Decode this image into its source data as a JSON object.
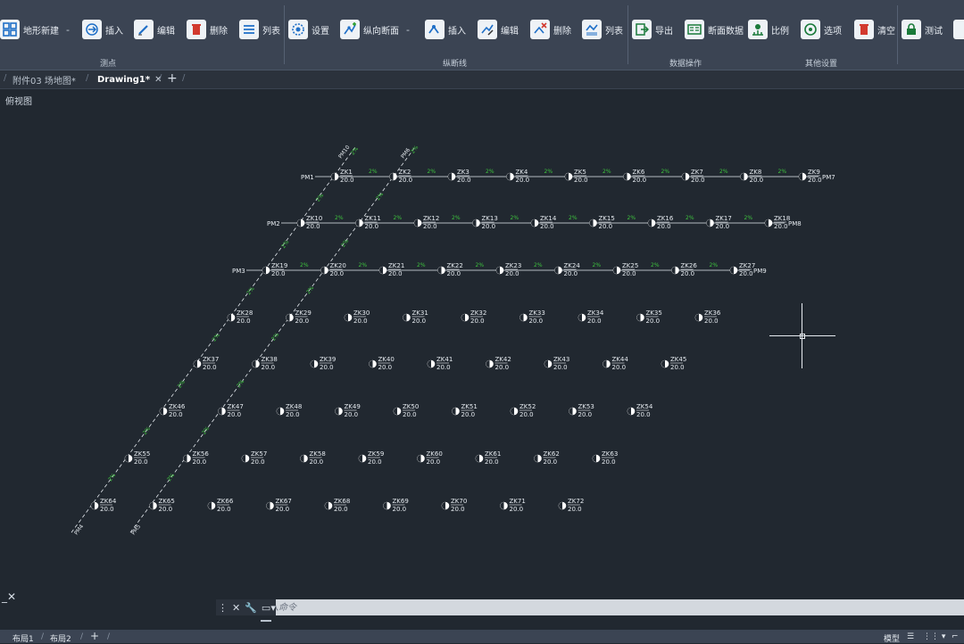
{
  "ribbon": {
    "buttons": [
      {
        "id": "terrain-new",
        "label": "地形新建",
        "icon": "grid-icon",
        "dash": true
      },
      {
        "id": "insert",
        "label": "插入",
        "icon": "insert-arrow-icon"
      },
      {
        "id": "edit",
        "label": "编辑",
        "icon": "edit-pen-icon"
      },
      {
        "id": "delete",
        "label": "删除",
        "icon": "trash-icon"
      },
      {
        "id": "list",
        "label": "列表",
        "icon": "list-icon"
      },
      {
        "id": "settings",
        "label": "设置",
        "icon": "gear-icon"
      },
      {
        "id": "profile-new",
        "label": "纵向断面",
        "icon": "profile-add-icon",
        "dash": true
      },
      {
        "id": "line-insert",
        "label": "插入",
        "icon": "line-insert-icon"
      },
      {
        "id": "line-edit",
        "label": "编辑",
        "icon": "line-edit-icon"
      },
      {
        "id": "line-delete",
        "label": "删除",
        "icon": "line-delete-icon"
      },
      {
        "id": "line-list",
        "label": "列表",
        "icon": "line-list-icon"
      },
      {
        "id": "export",
        "label": "导出",
        "icon": "export-icon"
      },
      {
        "id": "section-data",
        "label": "断面数据",
        "icon": "section-data-icon"
      },
      {
        "id": "scale",
        "label": "比例",
        "icon": "scale-icon"
      },
      {
        "id": "options",
        "label": "选项",
        "icon": "target-icon"
      },
      {
        "id": "clear",
        "label": "清空",
        "icon": "clear-icon"
      },
      {
        "id": "lock",
        "label": "测试",
        "icon": "lock-icon"
      }
    ],
    "groups": [
      "测点",
      "纵断线",
      "数据操作",
      "其他设置"
    ]
  },
  "tabs": [
    {
      "label": "附件03  场地图*",
      "active": false
    },
    {
      "label": "Drawing1*",
      "active": true
    }
  ],
  "view_label": "俯视图",
  "drawing": {
    "rows": [
      {
        "start": "PM1",
        "end": "PM7",
        "dims": [
          "2%",
          "2%",
          "2%",
          "2%",
          "2%",
          "2%",
          "2%",
          "2%"
        ],
        "points": [
          {
            "n": "ZK1",
            "e": "20.0"
          },
          {
            "n": "ZK2",
            "e": "20.0"
          },
          {
            "n": "ZK3",
            "e": "20.0"
          },
          {
            "n": "ZK4",
            "e": "20.0"
          },
          {
            "n": "ZK5",
            "e": "20.0"
          },
          {
            "n": "ZK6",
            "e": "20.0"
          },
          {
            "n": "ZK7",
            "e": "20.0"
          },
          {
            "n": "ZK8",
            "e": "20.0"
          },
          {
            "n": "ZK9",
            "e": "20.0"
          }
        ]
      },
      {
        "start": "PM2",
        "end": "PM8",
        "dims": [
          "2%",
          "2%",
          "2%",
          "2%",
          "2%",
          "2%",
          "2%",
          "2%"
        ],
        "points": [
          {
            "n": "ZK10",
            "e": "20.0"
          },
          {
            "n": "ZK11",
            "e": "20.0"
          },
          {
            "n": "ZK12",
            "e": "20.0"
          },
          {
            "n": "ZK13",
            "e": "20.0"
          },
          {
            "n": "ZK14",
            "e": "20.0"
          },
          {
            "n": "ZK15",
            "e": "20.0"
          },
          {
            "n": "ZK16",
            "e": "20.0"
          },
          {
            "n": "ZK17",
            "e": "20.0"
          },
          {
            "n": "ZK18",
            "e": "20.0"
          }
        ]
      },
      {
        "start": "PM3",
        "end": "PM9",
        "dims": [
          "2%",
          "2%",
          "2%",
          "2%",
          "2%",
          "2%",
          "2%",
          "2%"
        ],
        "points": [
          {
            "n": "ZK19",
            "e": "20.0"
          },
          {
            "n": "ZK20",
            "e": "20.0"
          },
          {
            "n": "ZK21",
            "e": "20.0"
          },
          {
            "n": "ZK22",
            "e": "20.0"
          },
          {
            "n": "ZK23",
            "e": "20.0"
          },
          {
            "n": "ZK24",
            "e": "20.0"
          },
          {
            "n": "ZK25",
            "e": "20.0"
          },
          {
            "n": "ZK26",
            "e": "20.0"
          },
          {
            "n": "ZK27",
            "e": "20.0"
          }
        ]
      },
      {
        "points": [
          {
            "n": "ZK28",
            "e": "20.0"
          },
          {
            "n": "ZK29",
            "e": "20.0"
          },
          {
            "n": "ZK30",
            "e": "20.0"
          },
          {
            "n": "ZK31",
            "e": "20.0"
          },
          {
            "n": "ZK32",
            "e": "20.0"
          },
          {
            "n": "ZK33",
            "e": "20.0"
          },
          {
            "n": "ZK34",
            "e": "20.0"
          },
          {
            "n": "ZK35",
            "e": "20.0"
          },
          {
            "n": "ZK36",
            "e": "20.0"
          }
        ]
      },
      {
        "points": [
          {
            "n": "ZK37",
            "e": "20.0"
          },
          {
            "n": "ZK38",
            "e": "20.0"
          },
          {
            "n": "ZK39",
            "e": "20.0"
          },
          {
            "n": "ZK40",
            "e": "20.0"
          },
          {
            "n": "ZK41",
            "e": "20.0"
          },
          {
            "n": "ZK42",
            "e": "20.0"
          },
          {
            "n": "ZK43",
            "e": "20.0"
          },
          {
            "n": "ZK44",
            "e": "20.0"
          },
          {
            "n": "ZK45",
            "e": "20.0"
          }
        ]
      },
      {
        "points": [
          {
            "n": "ZK46",
            "e": "20.0"
          },
          {
            "n": "ZK47",
            "e": "20.0"
          },
          {
            "n": "ZK48",
            "e": "20.0"
          },
          {
            "n": "ZK49",
            "e": "20.0"
          },
          {
            "n": "ZK50",
            "e": "20.0"
          },
          {
            "n": "ZK51",
            "e": "20.0"
          },
          {
            "n": "ZK52",
            "e": "20.0"
          },
          {
            "n": "ZK53",
            "e": "20.0"
          },
          {
            "n": "ZK54",
            "e": "20.0"
          }
        ]
      },
      {
        "points": [
          {
            "n": "ZK55",
            "e": "20.0"
          },
          {
            "n": "ZK56",
            "e": "20.0"
          },
          {
            "n": "ZK57",
            "e": "20.0"
          },
          {
            "n": "ZK58",
            "e": "20.0"
          },
          {
            "n": "ZK59",
            "e": "20.0"
          },
          {
            "n": "ZK60",
            "e": "20.0"
          },
          {
            "n": "ZK61",
            "e": "20.0"
          },
          {
            "n": "ZK62",
            "e": "20.0"
          },
          {
            "n": "ZK63",
            "e": "20.0"
          }
        ]
      },
      {
        "points": [
          {
            "n": "ZK64",
            "e": "20.0"
          },
          {
            "n": "ZK65",
            "e": "20.0"
          },
          {
            "n": "ZK66",
            "e": "20.0"
          },
          {
            "n": "ZK67",
            "e": "20.0"
          },
          {
            "n": "ZK68",
            "e": "20.0"
          },
          {
            "n": "ZK69",
            "e": "20.0"
          },
          {
            "n": "ZK70",
            "e": "20.0"
          },
          {
            "n": "ZK71",
            "e": "20.0"
          },
          {
            "n": "ZK72",
            "e": "20.0"
          }
        ]
      }
    ],
    "diag_labels": [
      "PM4",
      "PM5",
      "PM6",
      "PM10"
    ],
    "diag_dim": "2%"
  },
  "command": {
    "placeholder": "键入命令"
  },
  "status": {
    "layout_tabs": [
      "布局1",
      "布局2"
    ],
    "model": "模型"
  },
  "colors": {
    "accent_green": "#3ec43e",
    "line": "#e6ebf0",
    "bg": "#212830"
  }
}
